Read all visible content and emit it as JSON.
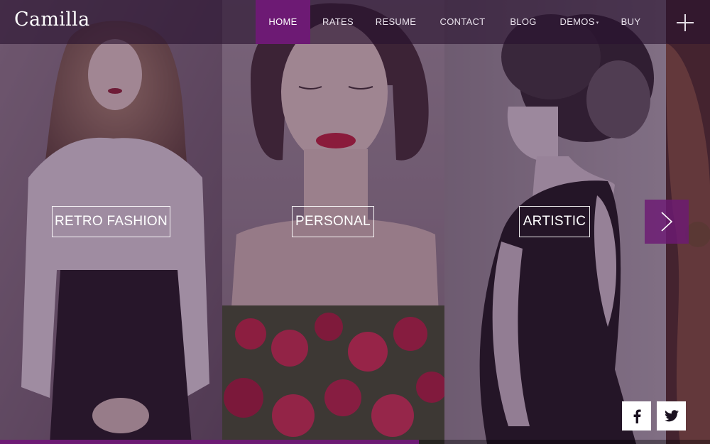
{
  "brand": {
    "logo_text": "Camilla"
  },
  "nav": {
    "items": [
      {
        "label": "HOME",
        "active": true
      },
      {
        "label": "RATES"
      },
      {
        "label": "RESUME"
      },
      {
        "label": "CONTACT"
      },
      {
        "label": "BLOG"
      },
      {
        "label": "DEMOS",
        "has_dropdown": true
      },
      {
        "label": "BUY"
      }
    ],
    "menu_icon": "plus-icon"
  },
  "gallery": {
    "panels": [
      {
        "label": "RETRO FASHION"
      },
      {
        "label": "PERSONAL"
      },
      {
        "label": "ARTISTIC"
      },
      {
        "label": ""
      }
    ],
    "next_icon": "chevron-right-icon"
  },
  "social": {
    "icons": [
      "facebook-icon",
      "twitter-icon"
    ]
  },
  "progress": {
    "fraction": 0.59
  },
  "colors": {
    "accent": "#6d1a74",
    "header_overlay": "#28122e",
    "text": "#ffffff"
  }
}
